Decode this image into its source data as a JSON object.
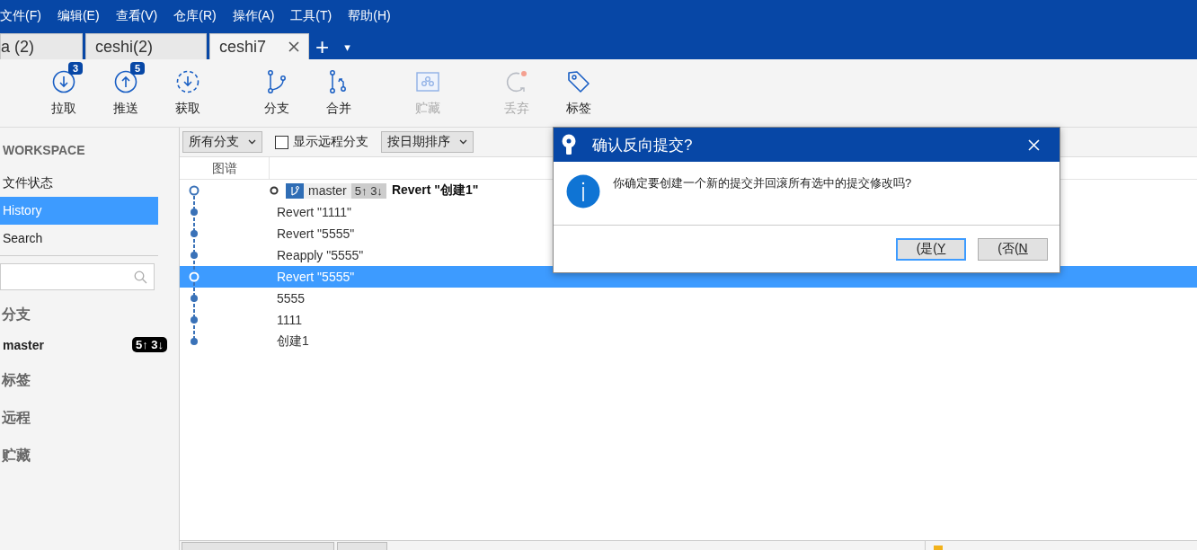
{
  "menu": [
    "文件(F)",
    "编辑(E)",
    "查看(V)",
    "仓库(R)",
    "操作(A)",
    "工具(T)",
    "帮助(H)"
  ],
  "tabs": [
    {
      "label": "a (2)",
      "selected": false
    },
    {
      "label": "ceshi(2)",
      "selected": false
    },
    {
      "label": "ceshi7",
      "selected": true
    }
  ],
  "tab_actions": [
    "+",
    "▾"
  ],
  "toolbar": [
    [
      {
        "label": "拉取",
        "badge": "3",
        "disabled": false
      },
      {
        "label": "推送",
        "badge": "5",
        "disabled": false
      },
      {
        "label": "获取",
        "disabled": false
      }
    ],
    [
      {
        "label": "分支",
        "disabled": false
      },
      {
        "label": "合并",
        "disabled": false
      }
    ],
    [
      {
        "label": "贮藏",
        "disabled": true
      }
    ],
    [
      {
        "label": "丢弃",
        "disabled": true
      },
      {
        "label": "标签",
        "disabled": false
      }
    ]
  ],
  "sidebar": {
    "workspace_title": "WORKSPACE",
    "items": [
      {
        "label": "文件状态",
        "selected": false
      },
      {
        "label": "History",
        "selected": true
      },
      {
        "label": "Search",
        "selected": false
      }
    ],
    "branches_title": "分支",
    "branches": [
      {
        "name": "master",
        "status": "5↑ 3↓"
      }
    ],
    "sections": [
      "标签",
      "远程",
      "贮藏"
    ]
  },
  "filter": {
    "branch_dropdown": "所有分支",
    "show_remote": {
      "label": "显示远程分支",
      "checked": false
    },
    "sort_dropdown": "按日期排序"
  },
  "columns": [
    "图谱"
  ],
  "commits": [
    {
      "message": "Revert \"创建1\"",
      "branch": "master",
      "ahead_behind": "5↑ 3↓",
      "selected": false
    },
    {
      "message": "Revert \"1111\"",
      "selected": false
    },
    {
      "message": "Revert \"5555\"",
      "selected": false
    },
    {
      "message": "Reapply \"5555\"",
      "selected": false
    },
    {
      "message": "Revert \"5555\"",
      "selected": true
    },
    {
      "message": "5555",
      "selected": false
    },
    {
      "message": "1111",
      "selected": false
    },
    {
      "message": "创建1",
      "selected": false
    }
  ],
  "dialog": {
    "title": "确认反向提交?",
    "message": "你确定要创建一个新的提交并回滚所有选中的提交修改吗?",
    "buttons": [
      {
        "label": "(是(",
        "accesskey": "Y",
        "selected": true
      },
      {
        "label": "(否(",
        "accesskey": "N",
        "selected": false
      }
    ]
  }
}
